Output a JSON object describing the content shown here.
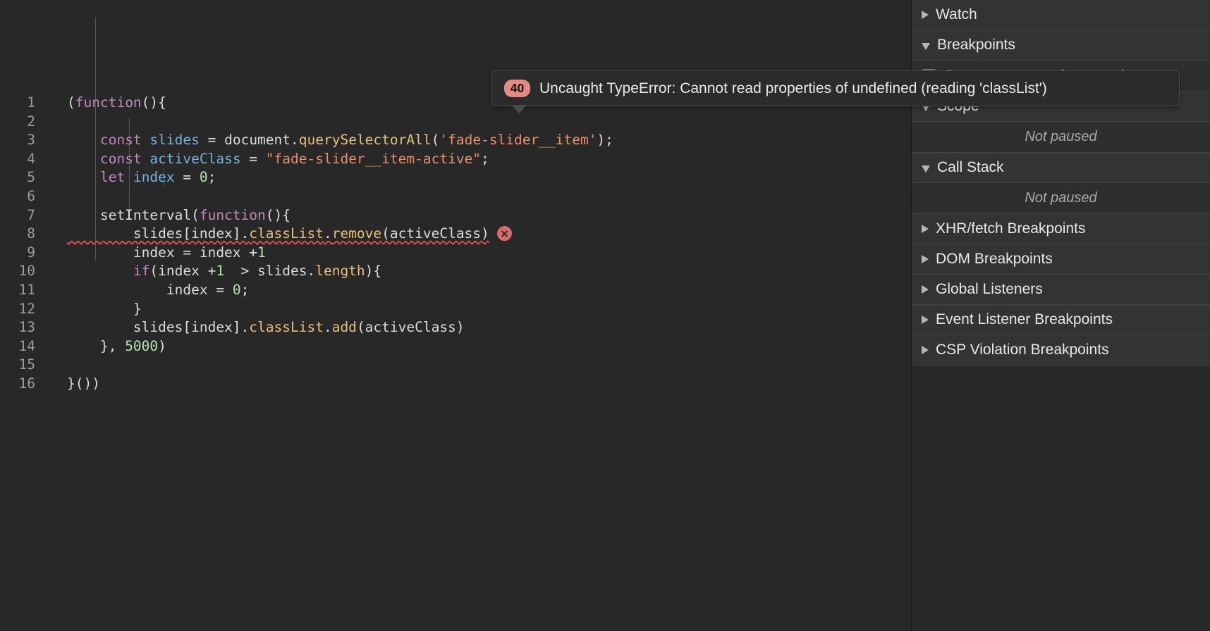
{
  "editor": {
    "name": "sources-code-editor",
    "language": "javascript",
    "line_count": 16,
    "lines": [
      {
        "number": "1",
        "tokens": [
          {
            "t": "(",
            "c": "punc"
          },
          {
            "t": "function",
            "c": "kw"
          },
          {
            "t": "(){",
            "c": "punc"
          }
        ]
      },
      {
        "number": "2",
        "tokens": []
      },
      {
        "number": "3",
        "tokens": [
          {
            "t": "    ",
            "c": "plain"
          },
          {
            "t": "const",
            "c": "decl"
          },
          {
            "t": " ",
            "c": "plain"
          },
          {
            "t": "slides",
            "c": "var"
          },
          {
            "t": " = document.",
            "c": "plain"
          },
          {
            "t": "querySelectorAll",
            "c": "fn"
          },
          {
            "t": "(",
            "c": "punc"
          },
          {
            "t": "'fade-slider__item'",
            "c": "str"
          },
          {
            "t": ");",
            "c": "punc"
          }
        ]
      },
      {
        "number": "4",
        "tokens": [
          {
            "t": "    ",
            "c": "plain"
          },
          {
            "t": "const",
            "c": "decl"
          },
          {
            "t": " ",
            "c": "plain"
          },
          {
            "t": "activeClass",
            "c": "var"
          },
          {
            "t": " = ",
            "c": "plain"
          },
          {
            "t": "\"fade-slider__item-active\"",
            "c": "str"
          },
          {
            "t": ";",
            "c": "punc"
          }
        ]
      },
      {
        "number": "5",
        "tokens": [
          {
            "t": "    ",
            "c": "plain"
          },
          {
            "t": "let",
            "c": "decl"
          },
          {
            "t": " ",
            "c": "plain"
          },
          {
            "t": "index",
            "c": "var"
          },
          {
            "t": " = ",
            "c": "plain"
          },
          {
            "t": "0",
            "c": "num"
          },
          {
            "t": ";",
            "c": "punc"
          }
        ]
      },
      {
        "number": "6",
        "tokens": []
      },
      {
        "number": "7",
        "tokens": [
          {
            "t": "    setInterval(",
            "c": "plain"
          },
          {
            "t": "function",
            "c": "kw"
          },
          {
            "t": "(){",
            "c": "punc"
          }
        ]
      },
      {
        "number": "8",
        "tokens": [
          {
            "t": "        slides[index].",
            "c": "plain"
          },
          {
            "t": "classList",
            "c": "fn"
          },
          {
            "t": ".",
            "c": "plain"
          },
          {
            "t": "remove",
            "c": "fn"
          },
          {
            "t": "(activeClass)",
            "c": "plain"
          }
        ],
        "has_error": true,
        "error_underline": true
      },
      {
        "number": "9",
        "tokens": [
          {
            "t": "        index = index +",
            "c": "plain"
          },
          {
            "t": "1",
            "c": "num"
          }
        ]
      },
      {
        "number": "10",
        "tokens": [
          {
            "t": "        ",
            "c": "plain"
          },
          {
            "t": "if",
            "c": "kw"
          },
          {
            "t": "(index +",
            "c": "plain"
          },
          {
            "t": "1",
            "c": "num"
          },
          {
            "t": "  > slides.",
            "c": "plain"
          },
          {
            "t": "length",
            "c": "fn"
          },
          {
            "t": "){",
            "c": "punc"
          }
        ]
      },
      {
        "number": "11",
        "tokens": [
          {
            "t": "            index = ",
            "c": "plain"
          },
          {
            "t": "0",
            "c": "num"
          },
          {
            "t": ";",
            "c": "punc"
          }
        ]
      },
      {
        "number": "12",
        "tokens": [
          {
            "t": "        }",
            "c": "punc"
          }
        ]
      },
      {
        "number": "13",
        "tokens": [
          {
            "t": "        slides[index].",
            "c": "plain"
          },
          {
            "t": "classList",
            "c": "fn"
          },
          {
            "t": ".",
            "c": "plain"
          },
          {
            "t": "add",
            "c": "fn"
          },
          {
            "t": "(activeClass)",
            "c": "plain"
          }
        ]
      },
      {
        "number": "14",
        "tokens": [
          {
            "t": "    }, ",
            "c": "punc"
          },
          {
            "t": "5000",
            "c": "num"
          },
          {
            "t": ")",
            "c": "punc"
          }
        ]
      },
      {
        "number": "15",
        "tokens": []
      },
      {
        "number": "16",
        "tokens": [
          {
            "t": "}())",
            "c": "punc"
          }
        ]
      }
    ]
  },
  "error_tooltip": {
    "badge_count": "40",
    "message": "Uncaught TypeError: Cannot read properties of undefined (reading 'classList')",
    "badge_color": "#e58a83",
    "icon": "error-circle-x-icon"
  },
  "sidebar": {
    "sections": [
      {
        "type": "section",
        "label": "Watch",
        "expanded": false,
        "name": "sidebar-section-watch"
      },
      {
        "type": "section",
        "label": "Breakpoints",
        "expanded": true,
        "name": "sidebar-section-breakpoints"
      },
      {
        "type": "checkbox",
        "label": "Pause on uncaught exceptions",
        "checked": false,
        "name": "pause-on-uncaught-exceptions-checkbox"
      },
      {
        "type": "section",
        "label": "Scope",
        "expanded": true,
        "name": "sidebar-section-scope"
      },
      {
        "type": "empty",
        "label": "Not paused",
        "name": "scope-not-paused-message"
      },
      {
        "type": "section",
        "label": "Call Stack",
        "expanded": true,
        "name": "sidebar-section-call-stack"
      },
      {
        "type": "empty",
        "label": "Not paused",
        "name": "call-stack-not-paused-message"
      },
      {
        "type": "section",
        "label": "XHR/fetch Breakpoints",
        "expanded": false,
        "name": "sidebar-section-xhr-fetch-breakpoints"
      },
      {
        "type": "section",
        "label": "DOM Breakpoints",
        "expanded": false,
        "name": "sidebar-section-dom-breakpoints"
      },
      {
        "type": "section",
        "label": "Global Listeners",
        "expanded": false,
        "name": "sidebar-section-global-listeners"
      },
      {
        "type": "section",
        "label": "Event Listener Breakpoints",
        "expanded": false,
        "name": "sidebar-section-event-listener-breakpoints"
      },
      {
        "type": "section",
        "label": "CSP Violation Breakpoints",
        "expanded": false,
        "name": "sidebar-section-csp-violation-breakpoints"
      }
    ]
  },
  "colors": {
    "editor_bg": "#282828",
    "sidebar_bg": "#333333",
    "error_red": "#e05252",
    "keyword_purple": "#c586c0",
    "string_orange": "#e8906a",
    "function_yellow": "#e5c07b",
    "number_green": "#b5e0b0",
    "variable_blue": "#6fb3e0"
  }
}
